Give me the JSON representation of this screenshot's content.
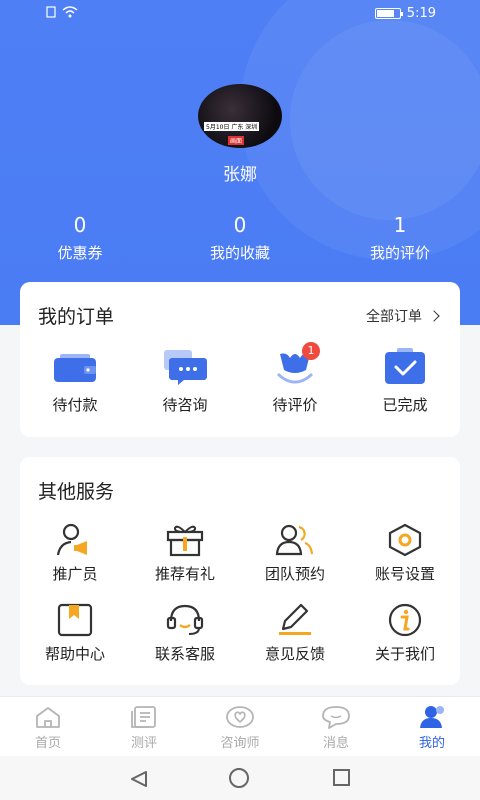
{
  "status": {
    "time": "5:19"
  },
  "profile": {
    "name": "张娜",
    "avatar_text": "5月10日 广东 深圳",
    "avatar_tag": "画面"
  },
  "stats": [
    {
      "value": "0",
      "label": "优惠券"
    },
    {
      "value": "0",
      "label": "我的收藏"
    },
    {
      "value": "1",
      "label": "我的评价"
    }
  ],
  "orders": {
    "title": "我的订单",
    "all_label": "全部订单",
    "items": [
      {
        "label": "待付款",
        "icon": "wallet-icon"
      },
      {
        "label": "待咨询",
        "icon": "chat-icon"
      },
      {
        "label": "待评价",
        "icon": "review-icon",
        "badge": "1"
      },
      {
        "label": "已完成",
        "icon": "completed-icon"
      }
    ]
  },
  "services": {
    "title": "其他服务",
    "items": [
      {
        "label": "推广员",
        "icon": "promoter-icon"
      },
      {
        "label": "推荐有礼",
        "icon": "gift-icon"
      },
      {
        "label": "团队预约",
        "icon": "team-icon"
      },
      {
        "label": "账号设置",
        "icon": "settings-icon"
      },
      {
        "label": "帮助中心",
        "icon": "help-book-icon"
      },
      {
        "label": "联系客服",
        "icon": "headset-icon"
      },
      {
        "label": "意见反馈",
        "icon": "edit-icon"
      },
      {
        "label": "关于我们",
        "icon": "info-icon"
      }
    ]
  },
  "tabs": [
    {
      "label": "首页",
      "icon": "home-icon"
    },
    {
      "label": "测评",
      "icon": "assessment-icon"
    },
    {
      "label": "咨询师",
      "icon": "counselor-icon"
    },
    {
      "label": "消息",
      "icon": "message-icon"
    },
    {
      "label": "我的",
      "icon": "profile-icon",
      "active": true
    }
  ],
  "colors": {
    "primary": "#4a7cf4",
    "accent": "#f5a623",
    "badge": "#f04a3e"
  }
}
